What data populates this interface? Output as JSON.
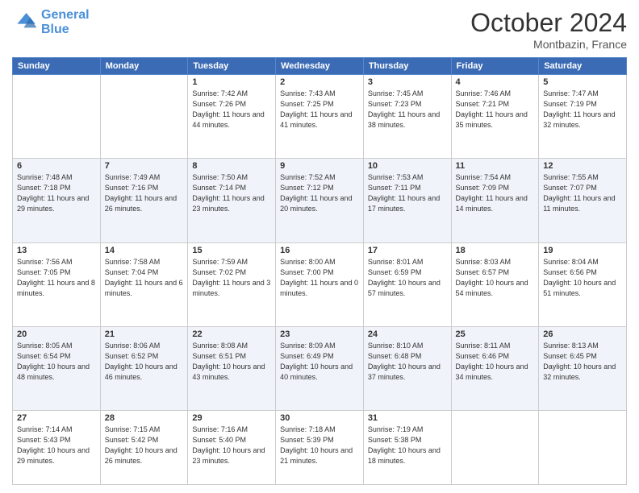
{
  "header": {
    "logo_line1": "General",
    "logo_line2": "Blue",
    "month": "October 2024",
    "location": "Montbazin, France"
  },
  "days_of_week": [
    "Sunday",
    "Monday",
    "Tuesday",
    "Wednesday",
    "Thursday",
    "Friday",
    "Saturday"
  ],
  "weeks": [
    [
      {
        "day": "",
        "sunrise": "",
        "sunset": "",
        "daylight": ""
      },
      {
        "day": "",
        "sunrise": "",
        "sunset": "",
        "daylight": ""
      },
      {
        "day": "1",
        "sunrise": "Sunrise: 7:42 AM",
        "sunset": "Sunset: 7:26 PM",
        "daylight": "Daylight: 11 hours and 44 minutes."
      },
      {
        "day": "2",
        "sunrise": "Sunrise: 7:43 AM",
        "sunset": "Sunset: 7:25 PM",
        "daylight": "Daylight: 11 hours and 41 minutes."
      },
      {
        "day": "3",
        "sunrise": "Sunrise: 7:45 AM",
        "sunset": "Sunset: 7:23 PM",
        "daylight": "Daylight: 11 hours and 38 minutes."
      },
      {
        "day": "4",
        "sunrise": "Sunrise: 7:46 AM",
        "sunset": "Sunset: 7:21 PM",
        "daylight": "Daylight: 11 hours and 35 minutes."
      },
      {
        "day": "5",
        "sunrise": "Sunrise: 7:47 AM",
        "sunset": "Sunset: 7:19 PM",
        "daylight": "Daylight: 11 hours and 32 minutes."
      }
    ],
    [
      {
        "day": "6",
        "sunrise": "Sunrise: 7:48 AM",
        "sunset": "Sunset: 7:18 PM",
        "daylight": "Daylight: 11 hours and 29 minutes."
      },
      {
        "day": "7",
        "sunrise": "Sunrise: 7:49 AM",
        "sunset": "Sunset: 7:16 PM",
        "daylight": "Daylight: 11 hours and 26 minutes."
      },
      {
        "day": "8",
        "sunrise": "Sunrise: 7:50 AM",
        "sunset": "Sunset: 7:14 PM",
        "daylight": "Daylight: 11 hours and 23 minutes."
      },
      {
        "day": "9",
        "sunrise": "Sunrise: 7:52 AM",
        "sunset": "Sunset: 7:12 PM",
        "daylight": "Daylight: 11 hours and 20 minutes."
      },
      {
        "day": "10",
        "sunrise": "Sunrise: 7:53 AM",
        "sunset": "Sunset: 7:11 PM",
        "daylight": "Daylight: 11 hours and 17 minutes."
      },
      {
        "day": "11",
        "sunrise": "Sunrise: 7:54 AM",
        "sunset": "Sunset: 7:09 PM",
        "daylight": "Daylight: 11 hours and 14 minutes."
      },
      {
        "day": "12",
        "sunrise": "Sunrise: 7:55 AM",
        "sunset": "Sunset: 7:07 PM",
        "daylight": "Daylight: 11 hours and 11 minutes."
      }
    ],
    [
      {
        "day": "13",
        "sunrise": "Sunrise: 7:56 AM",
        "sunset": "Sunset: 7:05 PM",
        "daylight": "Daylight: 11 hours and 8 minutes."
      },
      {
        "day": "14",
        "sunrise": "Sunrise: 7:58 AM",
        "sunset": "Sunset: 7:04 PM",
        "daylight": "Daylight: 11 hours and 6 minutes."
      },
      {
        "day": "15",
        "sunrise": "Sunrise: 7:59 AM",
        "sunset": "Sunset: 7:02 PM",
        "daylight": "Daylight: 11 hours and 3 minutes."
      },
      {
        "day": "16",
        "sunrise": "Sunrise: 8:00 AM",
        "sunset": "Sunset: 7:00 PM",
        "daylight": "Daylight: 11 hours and 0 minutes."
      },
      {
        "day": "17",
        "sunrise": "Sunrise: 8:01 AM",
        "sunset": "Sunset: 6:59 PM",
        "daylight": "Daylight: 10 hours and 57 minutes."
      },
      {
        "day": "18",
        "sunrise": "Sunrise: 8:03 AM",
        "sunset": "Sunset: 6:57 PM",
        "daylight": "Daylight: 10 hours and 54 minutes."
      },
      {
        "day": "19",
        "sunrise": "Sunrise: 8:04 AM",
        "sunset": "Sunset: 6:56 PM",
        "daylight": "Daylight: 10 hours and 51 minutes."
      }
    ],
    [
      {
        "day": "20",
        "sunrise": "Sunrise: 8:05 AM",
        "sunset": "Sunset: 6:54 PM",
        "daylight": "Daylight: 10 hours and 48 minutes."
      },
      {
        "day": "21",
        "sunrise": "Sunrise: 8:06 AM",
        "sunset": "Sunset: 6:52 PM",
        "daylight": "Daylight: 10 hours and 46 minutes."
      },
      {
        "day": "22",
        "sunrise": "Sunrise: 8:08 AM",
        "sunset": "Sunset: 6:51 PM",
        "daylight": "Daylight: 10 hours and 43 minutes."
      },
      {
        "day": "23",
        "sunrise": "Sunrise: 8:09 AM",
        "sunset": "Sunset: 6:49 PM",
        "daylight": "Daylight: 10 hours and 40 minutes."
      },
      {
        "day": "24",
        "sunrise": "Sunrise: 8:10 AM",
        "sunset": "Sunset: 6:48 PM",
        "daylight": "Daylight: 10 hours and 37 minutes."
      },
      {
        "day": "25",
        "sunrise": "Sunrise: 8:11 AM",
        "sunset": "Sunset: 6:46 PM",
        "daylight": "Daylight: 10 hours and 34 minutes."
      },
      {
        "day": "26",
        "sunrise": "Sunrise: 8:13 AM",
        "sunset": "Sunset: 6:45 PM",
        "daylight": "Daylight: 10 hours and 32 minutes."
      }
    ],
    [
      {
        "day": "27",
        "sunrise": "Sunrise: 7:14 AM",
        "sunset": "Sunset: 5:43 PM",
        "daylight": "Daylight: 10 hours and 29 minutes."
      },
      {
        "day": "28",
        "sunrise": "Sunrise: 7:15 AM",
        "sunset": "Sunset: 5:42 PM",
        "daylight": "Daylight: 10 hours and 26 minutes."
      },
      {
        "day": "29",
        "sunrise": "Sunrise: 7:16 AM",
        "sunset": "Sunset: 5:40 PM",
        "daylight": "Daylight: 10 hours and 23 minutes."
      },
      {
        "day": "30",
        "sunrise": "Sunrise: 7:18 AM",
        "sunset": "Sunset: 5:39 PM",
        "daylight": "Daylight: 10 hours and 21 minutes."
      },
      {
        "day": "31",
        "sunrise": "Sunrise: 7:19 AM",
        "sunset": "Sunset: 5:38 PM",
        "daylight": "Daylight: 10 hours and 18 minutes."
      },
      {
        "day": "",
        "sunrise": "",
        "sunset": "",
        "daylight": ""
      },
      {
        "day": "",
        "sunrise": "",
        "sunset": "",
        "daylight": ""
      }
    ]
  ]
}
